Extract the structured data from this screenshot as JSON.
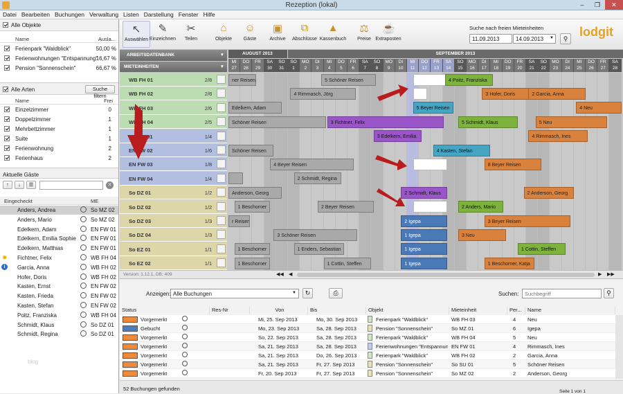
{
  "window": {
    "title": "Rezeption (lokal)"
  },
  "menu": [
    "Datei",
    "Bearbeiten",
    "Buchungen",
    "Verwaltung",
    "Listen",
    "Darstellung",
    "Fenster",
    "Hilfe"
  ],
  "objects": {
    "header": "Alle Objekte",
    "col_name": "Name",
    "col_load": "Ausla...",
    "items": [
      {
        "name": "Ferienpark \"Waldblick\"",
        "value": "50,00 %"
      },
      {
        "name": "Ferienwohnungen \"Entspannung\"",
        "value": "16,67 %"
      },
      {
        "name": "Pension \"Sonnenschein\"",
        "value": "66,67 %"
      }
    ]
  },
  "types": {
    "header": "Alle Arten",
    "search_button": "Suche filtern",
    "col_name": "Name",
    "col_free": "Frei",
    "items": [
      {
        "name": "Einzelzimmer",
        "value": "0"
      },
      {
        "name": "Doppelzimmer",
        "value": "1"
      },
      {
        "name": "Mehrbettzimmer",
        "value": "1"
      },
      {
        "name": "Suite",
        "value": "1"
      },
      {
        "name": "Ferienwohnung",
        "value": "2"
      },
      {
        "name": "Ferienhaus",
        "value": "2"
      }
    ]
  },
  "guests": {
    "header": "Aktuelle Gäste",
    "col_checkin": "Eingecheckt",
    "col_me": "ME",
    "items": [
      {
        "name": "Anders, Andrea",
        "me": "So MZ 02"
      },
      {
        "name": "Anders, Mario",
        "me": "So MZ 02"
      },
      {
        "name": "Edelkern, Adam",
        "me": "EN FW 01"
      },
      {
        "name": "Edelkern, Emilia Sophie",
        "me": "EN FW 01"
      },
      {
        "name": "Edelkern, Matthias",
        "me": "EN FW 01"
      },
      {
        "name": "Fichtner, Felix",
        "me": "WB FH 04"
      },
      {
        "name": "Garcia, Anna",
        "me": "WB FH 02"
      },
      {
        "name": "Hofer, Doris",
        "me": "WB FH 02"
      },
      {
        "name": "Kasten, Ernst",
        "me": "EN FW 02"
      },
      {
        "name": "Kasten, Frieda",
        "me": "EN FW 02"
      },
      {
        "name": "Kasten, Stefan",
        "me": "EN FW 02"
      },
      {
        "name": "Poitz, Franziska",
        "me": "WB FH 04"
      },
      {
        "name": "Schmidt, Klaus",
        "me": "So DZ 01"
      },
      {
        "name": "Schmidt, Regina",
        "me": "So DZ 01"
      }
    ]
  },
  "toolbar": {
    "tools": [
      "Auswählen",
      "Einzeichnen",
      "Teilen",
      "Objekte",
      "Gäste",
      "Archive",
      "Abschlüsse",
      "Kassenbuch",
      "Preise",
      "Extraposten"
    ],
    "search_label": "Suche nach freien Mieteinheiten",
    "date_from": "11.09.2013",
    "date_to": "14.09.2013",
    "logo": "lodgit"
  },
  "grid": {
    "arbeitsdatenbank": "ARBEITSDATENBANK",
    "mieteinheiten": "MIETEINHEITEN",
    "month_aug": "AUGUST 2013",
    "month_sep": "SEPTEMBER 2013",
    "days": [
      [
        "MI",
        "27"
      ],
      [
        "DO",
        "28"
      ],
      [
        "FR",
        "29"
      ],
      [
        "SA",
        "30"
      ],
      [
        "SO",
        "31"
      ],
      [
        "SO",
        "1"
      ],
      [
        "MO",
        "2"
      ],
      [
        "DI",
        "3"
      ],
      [
        "MI",
        "4"
      ],
      [
        "DO",
        "5"
      ],
      [
        "FR",
        "6"
      ],
      [
        "SA",
        "7"
      ],
      [
        "SO",
        "8"
      ],
      [
        "MO",
        "9"
      ],
      [
        "DI",
        "10"
      ],
      [
        "MI",
        "11"
      ],
      [
        "DO",
        "12"
      ],
      [
        "FR",
        "13"
      ],
      [
        "SA",
        "14"
      ],
      [
        "SO",
        "15"
      ],
      [
        "MO",
        "16"
      ],
      [
        "DI",
        "17"
      ],
      [
        "MI",
        "18"
      ],
      [
        "DO",
        "19"
      ],
      [
        "FR",
        "20"
      ],
      [
        "SA",
        "21"
      ],
      [
        "SO",
        "22"
      ],
      [
        "MO",
        "23"
      ],
      [
        "DI",
        "24"
      ],
      [
        "MI",
        "25"
      ],
      [
        "DO",
        "26"
      ],
      [
        "FR",
        "27"
      ],
      [
        "SA",
        "28"
      ]
    ],
    "rows": [
      {
        "name": "WB FH 01",
        "cap": "2/8",
        "color": "#bcdcb2"
      },
      {
        "name": "WB FH 02",
        "cap": "2/8",
        "color": "#bcdcb2"
      },
      {
        "name": "WB FH 03",
        "cap": "2/6",
        "color": "#bcdcb2"
      },
      {
        "name": "WB FH 04",
        "cap": "2/5",
        "color": "#bcdcb2"
      },
      {
        "name": "EN FW 01",
        "cap": "1/4",
        "color": "#b3bfe0"
      },
      {
        "name": "EN FW 02",
        "cap": "1/6",
        "color": "#b3bfe0"
      },
      {
        "name": "EN FW 03",
        "cap": "1/8",
        "color": "#b3bfe0"
      },
      {
        "name": "EN FW 04",
        "cap": "1/4",
        "color": "#b3bfe0"
      },
      {
        "name": "So DZ 01",
        "cap": "1/2",
        "color": "#ddd6a8"
      },
      {
        "name": "So DZ 02",
        "cap": "1/2",
        "color": "#ddd6a8"
      },
      {
        "name": "So DZ 03",
        "cap": "1/3",
        "color": "#ddd6a8"
      },
      {
        "name": "So DZ 04",
        "cap": "1/3",
        "color": "#ddd6a8"
      },
      {
        "name": "So EZ 01",
        "cap": "1/1",
        "color": "#ddd6a8"
      },
      {
        "name": "So EZ 02",
        "cap": "1/1",
        "color": "#ddd6a8"
      }
    ],
    "bookings": [
      {
        "row": 0,
        "start": 0,
        "len": 2.3,
        "label": "ner Reisen",
        "cls": "bk-grey"
      },
      {
        "row": 0,
        "start": 7.8,
        "len": 4.6,
        "label": "5 Schöner Reisen",
        "cls": "bk-grey"
      },
      {
        "row": 0,
        "start": 15.5,
        "len": 2.9,
        "label": "",
        "cls": "bk-white"
      },
      {
        "row": 0,
        "start": 18.2,
        "len": 4.0,
        "label": "4 Poitz, Franziska",
        "cls": "bk-green"
      },
      {
        "row": 1,
        "start": 5.2,
        "len": 5.5,
        "label": "4 Rimmasch, Jörg",
        "cls": "bk-grey"
      },
      {
        "row": 1,
        "start": 15.5,
        "len": 1.2,
        "label": "",
        "cls": "bk-white"
      },
      {
        "row": 1,
        "start": 21.3,
        "len": 4.2,
        "label": "3 Hofer, Doris",
        "cls": "bk-orange"
      },
      {
        "row": 1,
        "start": 25.2,
        "len": 4.8,
        "label": "2 Garcia, Anna",
        "cls": "bk-orange"
      },
      {
        "row": 2,
        "start": 0,
        "len": 4.5,
        "label": "Edelkern, Adam",
        "cls": "bk-grey"
      },
      {
        "row": 2,
        "start": 15.5,
        "len": 3.4,
        "label": "5 Beyer Reisen",
        "cls": "bk-teal"
      },
      {
        "row": 2,
        "start": 29.2,
        "len": 3.8,
        "label": "4 Neu",
        "cls": "bk-orange"
      },
      {
        "row": 3,
        "start": 0,
        "len": 8.2,
        "label": "Schöner Reisen",
        "cls": "bk-grey"
      },
      {
        "row": 3,
        "start": 8.3,
        "len": 9.8,
        "label": "3 Fichtner, Felix",
        "cls": "bk-purple"
      },
      {
        "row": 3,
        "start": 19.3,
        "len": 5.0,
        "label": "5 Schmidt, Klaus",
        "cls": "bk-green"
      },
      {
        "row": 3,
        "start": 25.8,
        "len": 6.0,
        "label": "5 Neu",
        "cls": "bk-orange"
      },
      {
        "row": 4,
        "start": 12.2,
        "len": 4.0,
        "label": "3 Edelkern, Emilia",
        "cls": "bk-purple"
      },
      {
        "row": 4,
        "start": 25.2,
        "len": 5.0,
        "label": "4 Rimmasch, Ines",
        "cls": "bk-orange"
      },
      {
        "row": 5,
        "start": 0,
        "len": 3.8,
        "label": "Schöner Reisen",
        "cls": "bk-grey"
      },
      {
        "row": 5,
        "start": 17.2,
        "len": 4.8,
        "label": "4 Kasten, Stefan",
        "cls": "bk-teal"
      },
      {
        "row": 6,
        "start": 3.5,
        "len": 7.0,
        "label": "4 Beyer Reisen",
        "cls": "bk-grey"
      },
      {
        "row": 6,
        "start": 15.5,
        "len": 2.9,
        "label": "",
        "cls": "bk-white"
      },
      {
        "row": 6,
        "start": 21.5,
        "len": 4.8,
        "label": "8 Beyer Reisen",
        "cls": "bk-orange"
      },
      {
        "row": 7,
        "start": 0,
        "len": 1.2,
        "label": "",
        "cls": "bk-grey"
      },
      {
        "row": 7,
        "start": 5.5,
        "len": 4.0,
        "label": "2 Schmidt, Regina",
        "cls": "bk-grey"
      },
      {
        "row": 8,
        "start": 0,
        "len": 4.5,
        "label": "Anderson, Georg",
        "cls": "bk-grey"
      },
      {
        "row": 8,
        "start": 14.5,
        "len": 3.9,
        "label": "2 Schmidt, Klaus",
        "cls": "bk-purple"
      },
      {
        "row": 8,
        "start": 24.8,
        "len": 4.2,
        "label": "2 Anderson, Georg",
        "cls": "bk-orange"
      },
      {
        "row": 9,
        "start": 0.5,
        "len": 3.0,
        "label": "1 Beschorner",
        "cls": "bk-grey"
      },
      {
        "row": 9,
        "start": 7.5,
        "len": 4.7,
        "label": "2 Beyer Reisen",
        "cls": "bk-grey"
      },
      {
        "row": 9,
        "start": 15.5,
        "len": 2.9,
        "label": "",
        "cls": "bk-white"
      },
      {
        "row": 9,
        "start": 19.3,
        "len": 3.8,
        "label": "2 Anders, Mario",
        "cls": "bk-green"
      },
      {
        "row": 10,
        "start": 0,
        "len": 1.8,
        "label": "r Reisen",
        "cls": "bk-grey"
      },
      {
        "row": 10,
        "start": 14.5,
        "len": 3.9,
        "label": "2 Igepa",
        "cls": "bk-blue"
      },
      {
        "row": 10,
        "start": 21.5,
        "len": 7.2,
        "label": "3 Beyer Reisen",
        "cls": "bk-orange"
      },
      {
        "row": 11,
        "start": 3.8,
        "len": 7.0,
        "label": "3 Schöner Reisen",
        "cls": "bk-grey"
      },
      {
        "row": 11,
        "start": 14.5,
        "len": 3.9,
        "label": "1 Igepa",
        "cls": "bk-blue"
      },
      {
        "row": 11,
        "start": 19.3,
        "len": 4.0,
        "label": "3 Neu",
        "cls": "bk-orange"
      },
      {
        "row": 12,
        "start": 0.5,
        "len": 3.0,
        "label": "1 Beschorner",
        "cls": "bk-grey"
      },
      {
        "row": 12,
        "start": 5.5,
        "len": 4.2,
        "label": "1 Enders, Sebastian",
        "cls": "bk-grey"
      },
      {
        "row": 12,
        "start": 14.5,
        "len": 3.9,
        "label": "1 Igepa",
        "cls": "bk-blue"
      },
      {
        "row": 12,
        "start": 24.3,
        "len": 4.0,
        "label": "1 Cottin, Steffen",
        "cls": "bk-green"
      },
      {
        "row": 13,
        "start": 0.5,
        "len": 3.0,
        "label": "1 Beschorner",
        "cls": "bk-grey"
      },
      {
        "row": 13,
        "start": 8.0,
        "len": 4.0,
        "label": "1 Cottin, Steffen",
        "cls": "bk-grey"
      },
      {
        "row": 13,
        "start": 14.5,
        "len": 3.9,
        "label": "1 Igepa",
        "cls": "bk-blue"
      },
      {
        "row": 13,
        "start": 21.5,
        "len": 4.2,
        "label": "1 Beschorner, Katja",
        "cls": "bk-orange"
      }
    ],
    "version": "Version: 1.12.1, DB: 409"
  },
  "list": {
    "show_label": "Anzeigen:",
    "show_value": "Alle Buchungen",
    "search_label": "Suchen:",
    "search_placeholder": "Suchbegriff",
    "headers": [
      "Status",
      "Res-Nr",
      "Von",
      "Bis",
      "Objekt",
      "Mieteinheit",
      "Per...",
      "Name"
    ],
    "rows": [
      {
        "status": "Vorgemerkt",
        "color": "#ef8a3a",
        "von": "Mi, 25. Sep 2013",
        "bis": "Mo, 30. Sep 2013",
        "objekt": "Ferienpark \"Waldblick\"",
        "obcolor": "#cfe7c4",
        "me": "WB FH 03",
        "per": "4",
        "name": "Neu"
      },
      {
        "status": "Gebucht",
        "color": "#4a7ec0",
        "von": "Mo, 23. Sep 2013",
        "bis": "Sa, 28. Sep 2013",
        "objekt": "Pension \"Sonnenschein\"",
        "obcolor": "#e7e2b8",
        "me": "So MZ 01",
        "per": "6",
        "name": "Igepa"
      },
      {
        "status": "Vorgemerkt",
        "color": "#ef8a3a",
        "von": "So, 22. Sep 2013",
        "bis": "Sa, 28. Sep 2013",
        "objekt": "Ferienpark \"Waldblick\"",
        "obcolor": "#cfe7c4",
        "me": "WB FH 04",
        "per": "5",
        "name": "Neu"
      },
      {
        "status": "Vorgemerkt",
        "color": "#ef8a3a",
        "von": "Sa, 21. Sep 2013",
        "bis": "Sa, 28. Sep 2013",
        "objekt": "Ferienwohnungen \"Entspannung\"",
        "obcolor": "#c2cbea",
        "me": "EN FW 01",
        "per": "4",
        "name": "Rimmasch, Ines"
      },
      {
        "status": "Vorgemerkt",
        "color": "#ef8a3a",
        "von": "Sa, 21. Sep 2013",
        "bis": "Do, 26. Sep 2013",
        "objekt": "Ferienpark \"Waldblick\"",
        "obcolor": "#cfe7c4",
        "me": "WB FH 02",
        "per": "2",
        "name": "Garcia, Anna"
      },
      {
        "status": "Vorgemerkt",
        "color": "#ef8a3a",
        "von": "Sa, 21. Sep 2013",
        "bis": "Fr, 27. Sep 2013",
        "objekt": "Pension \"Sonnenschein\"",
        "obcolor": "#e7e2b8",
        "me": "So SU 01",
        "per": "5",
        "name": "Schöner Reisen"
      },
      {
        "status": "Vorgemerkt",
        "color": "#ef8a3a",
        "von": "Fr, 20. Sep 2013",
        "bis": "Fr, 27. Sep 2013",
        "objekt": "Pension \"Sonnenschein\"",
        "obcolor": "#e7e2b8",
        "me": "So MZ 02",
        "per": "2",
        "name": "Anderson, Georg"
      }
    ],
    "footer": "52 Buchungen gefunden",
    "page": "Seite 1 von 1"
  },
  "watermark": "blog"
}
